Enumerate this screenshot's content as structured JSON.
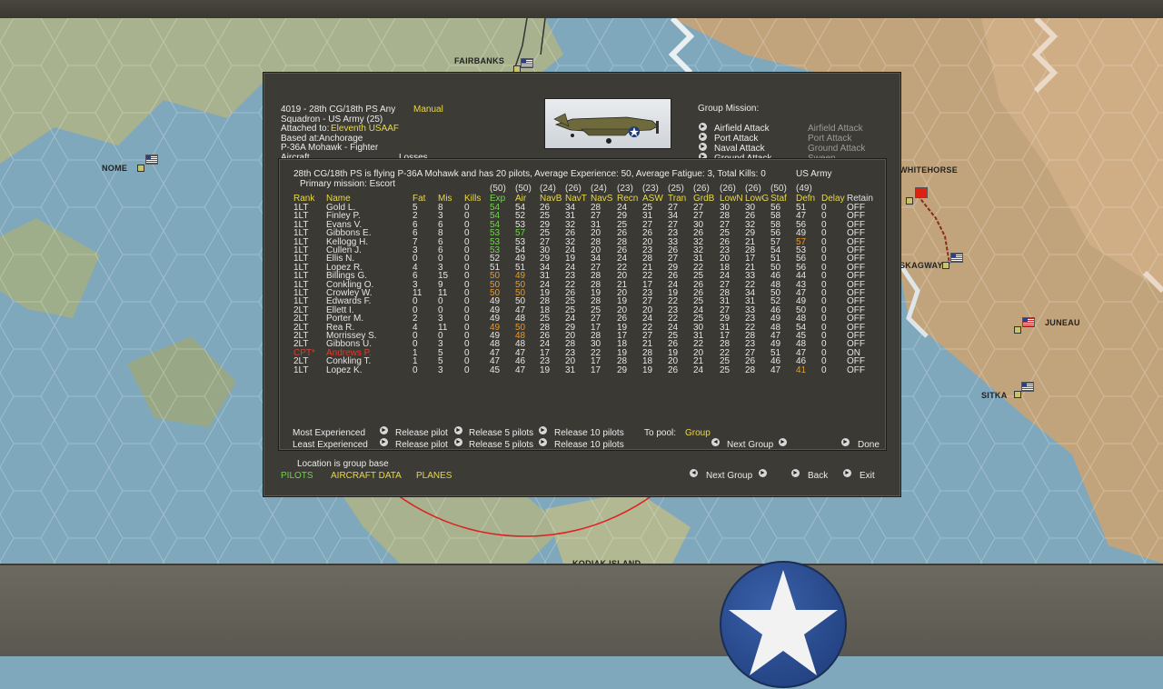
{
  "map": {
    "labels": [
      "FAIRBANKS",
      "NOME",
      "WHITEHORSE",
      "SKAGWAY",
      "JUNEAU",
      "SITKA",
      "KODIAK ISLAND"
    ]
  },
  "group": {
    "header_line": "4019 - 28th CG/18th PS",
    "any": "Any",
    "mode": "Manual",
    "squadron": "Squadron - US Army (25)",
    "attached_label": "Attached to:",
    "attached_value": "Eleventh USAAF",
    "based_label": "Based at:",
    "based_value": "Anchorage",
    "aircraft_type": "P-36A Mohawk - Fighter",
    "aircraft_label": "Aircraft",
    "losses_label": "Losses"
  },
  "mission": {
    "title": "Group Mission:",
    "options": [
      {
        "label": "Airfield Attack",
        "alt": "Airfield Attack"
      },
      {
        "label": "Port Attack",
        "alt": "Port Attack"
      },
      {
        "label": "Naval Attack",
        "alt": "Ground Attack"
      },
      {
        "label": "Ground Attack",
        "alt": "Sweep"
      }
    ]
  },
  "pilots": {
    "summary": "28th CG/18th PS is flying P-36A Mohawk and has 20 pilots,  Average Experience: 50, Average Fatigue: 3, Total Kills: 0",
    "service": "US Army",
    "primary_mission": "Primary mission: Escort",
    "max_values": [
      "(50)",
      "(50)",
      "(24)",
      "(26)",
      "(24)",
      "(23)",
      "(23)",
      "(25)",
      "(26)",
      "(26)",
      "(26)",
      "(50)",
      "(49)"
    ],
    "columns": [
      "Rank",
      "Name",
      "Fat",
      "Mis",
      "Kills",
      "Exp",
      "Air",
      "NavB",
      "NavT",
      "NavS",
      "Recn",
      "ASW",
      "Tran",
      "GrdB",
      "LowN",
      "LowG",
      "Staf",
      "Defn",
      "Delay",
      "Retain"
    ],
    "rows": [
      [
        "1LT",
        "Gold L.",
        "5",
        "8",
        "0",
        "54",
        "54",
        "26",
        "34",
        "28",
        "24",
        "25",
        "27",
        "27",
        "30",
        "30",
        "56",
        "51",
        "0",
        "OFF"
      ],
      [
        "1LT",
        "Finley P.",
        "2",
        "3",
        "0",
        "54",
        "52",
        "25",
        "31",
        "27",
        "29",
        "31",
        "34",
        "27",
        "28",
        "26",
        "58",
        "47",
        "0",
        "OFF"
      ],
      [
        "1LT",
        "Evans V.",
        "6",
        "6",
        "0",
        "54",
        "53",
        "29",
        "32",
        "31",
        "25",
        "27",
        "27",
        "30",
        "27",
        "32",
        "58",
        "56",
        "0",
        "OFF"
      ],
      [
        "1LT",
        "Gibbons E.",
        "6",
        "8",
        "0",
        "53",
        "57",
        "25",
        "26",
        "20",
        "26",
        "26",
        "23",
        "26",
        "25",
        "29",
        "56",
        "49",
        "0",
        "OFF"
      ],
      [
        "1LT",
        "Kellogg H.",
        "7",
        "6",
        "0",
        "53",
        "53",
        "27",
        "32",
        "28",
        "28",
        "20",
        "33",
        "32",
        "26",
        "21",
        "57",
        "57",
        "0",
        "OFF"
      ],
      [
        "1LT",
        "Cullen J.",
        "3",
        "6",
        "0",
        "53",
        "54",
        "30",
        "24",
        "20",
        "26",
        "23",
        "26",
        "32",
        "23",
        "28",
        "54",
        "53",
        "0",
        "OFF"
      ],
      [
        "1LT",
        "Ellis N.",
        "0",
        "0",
        "0",
        "52",
        "49",
        "29",
        "19",
        "34",
        "24",
        "28",
        "27",
        "31",
        "20",
        "17",
        "51",
        "56",
        "0",
        "OFF"
      ],
      [
        "1LT",
        "Lopez R.",
        "4",
        "3",
        "0",
        "51",
        "51",
        "34",
        "24",
        "27",
        "22",
        "21",
        "29",
        "22",
        "18",
        "21",
        "50",
        "56",
        "0",
        "OFF"
      ],
      [
        "1LT",
        "Billings G.",
        "6",
        "15",
        "0",
        "50",
        "49",
        "31",
        "23",
        "28",
        "20",
        "22",
        "26",
        "25",
        "24",
        "33",
        "46",
        "44",
        "0",
        "OFF"
      ],
      [
        "1LT",
        "Conkling O.",
        "3",
        "9",
        "0",
        "50",
        "50",
        "24",
        "22",
        "28",
        "21",
        "17",
        "24",
        "26",
        "27",
        "22",
        "48",
        "43",
        "0",
        "OFF"
      ],
      [
        "1LT",
        "Crowley W.",
        "11",
        "11",
        "0",
        "50",
        "50",
        "19",
        "26",
        "19",
        "20",
        "23",
        "19",
        "26",
        "28",
        "34",
        "50",
        "47",
        "0",
        "OFF"
      ],
      [
        "1LT",
        "Edwards F.",
        "0",
        "0",
        "0",
        "49",
        "50",
        "28",
        "25",
        "28",
        "19",
        "27",
        "22",
        "25",
        "31",
        "31",
        "52",
        "49",
        "0",
        "OFF"
      ],
      [
        "2LT",
        "Ellett I.",
        "0",
        "0",
        "0",
        "49",
        "47",
        "18",
        "25",
        "25",
        "20",
        "20",
        "23",
        "24",
        "27",
        "33",
        "46",
        "50",
        "0",
        "OFF"
      ],
      [
        "2LT",
        "Porter M.",
        "2",
        "3",
        "0",
        "49",
        "48",
        "25",
        "24",
        "27",
        "26",
        "24",
        "22",
        "25",
        "29",
        "23",
        "49",
        "48",
        "0",
        "OFF"
      ],
      [
        "2LT",
        "Rea R.",
        "4",
        "11",
        "0",
        "49",
        "50",
        "28",
        "29",
        "17",
        "19",
        "22",
        "24",
        "30",
        "31",
        "22",
        "48",
        "54",
        "0",
        "OFF"
      ],
      [
        "2LT",
        "Morrissey S.",
        "0",
        "0",
        "0",
        "49",
        "48",
        "26",
        "20",
        "28",
        "17",
        "27",
        "25",
        "31",
        "17",
        "28",
        "47",
        "45",
        "0",
        "OFF"
      ],
      [
        "2LT",
        "Gibbons U.",
        "0",
        "3",
        "0",
        "48",
        "48",
        "24",
        "28",
        "30",
        "18",
        "21",
        "26",
        "22",
        "28",
        "23",
        "49",
        "48",
        "0",
        "OFF"
      ],
      [
        "CPT*",
        "Andrews P.",
        "1",
        "5",
        "0",
        "47",
        "47",
        "17",
        "23",
        "22",
        "19",
        "28",
        "19",
        "20",
        "22",
        "27",
        "51",
        "47",
        "0",
        "ON"
      ],
      [
        "2LT",
        "Conkling T.",
        "1",
        "5",
        "0",
        "47",
        "46",
        "23",
        "20",
        "17",
        "28",
        "18",
        "20",
        "21",
        "25",
        "26",
        "46",
        "46",
        "0",
        "OFF"
      ],
      [
        "1LT",
        "Lopez K.",
        "0",
        "3",
        "0",
        "45",
        "47",
        "19",
        "31",
        "17",
        "29",
        "19",
        "26",
        "24",
        "25",
        "28",
        "47",
        "41",
        "0",
        "OFF"
      ]
    ]
  },
  "actions": {
    "most_experienced": "Most Experienced",
    "least_experienced": "Least Experienced",
    "release_pilot": "Release pilot",
    "release_5": "Release 5 pilots",
    "release_10": "Release 10 pilots",
    "to_pool_label": "To pool:",
    "to_pool_value": "Group",
    "next_group_inner": "Next Group",
    "done": "Done"
  },
  "footer": {
    "location": "Location is group base",
    "tabs": [
      "PILOTS",
      "AIRCRAFT DATA",
      "PLANES"
    ],
    "next_group": "Next Group",
    "back": "Back",
    "exit": "Exit"
  },
  "colors": {
    "highlight_yellow": "#e8d84a",
    "green": "#6ed64a",
    "orange": "#e89a2a",
    "red": "#e03a2a"
  }
}
